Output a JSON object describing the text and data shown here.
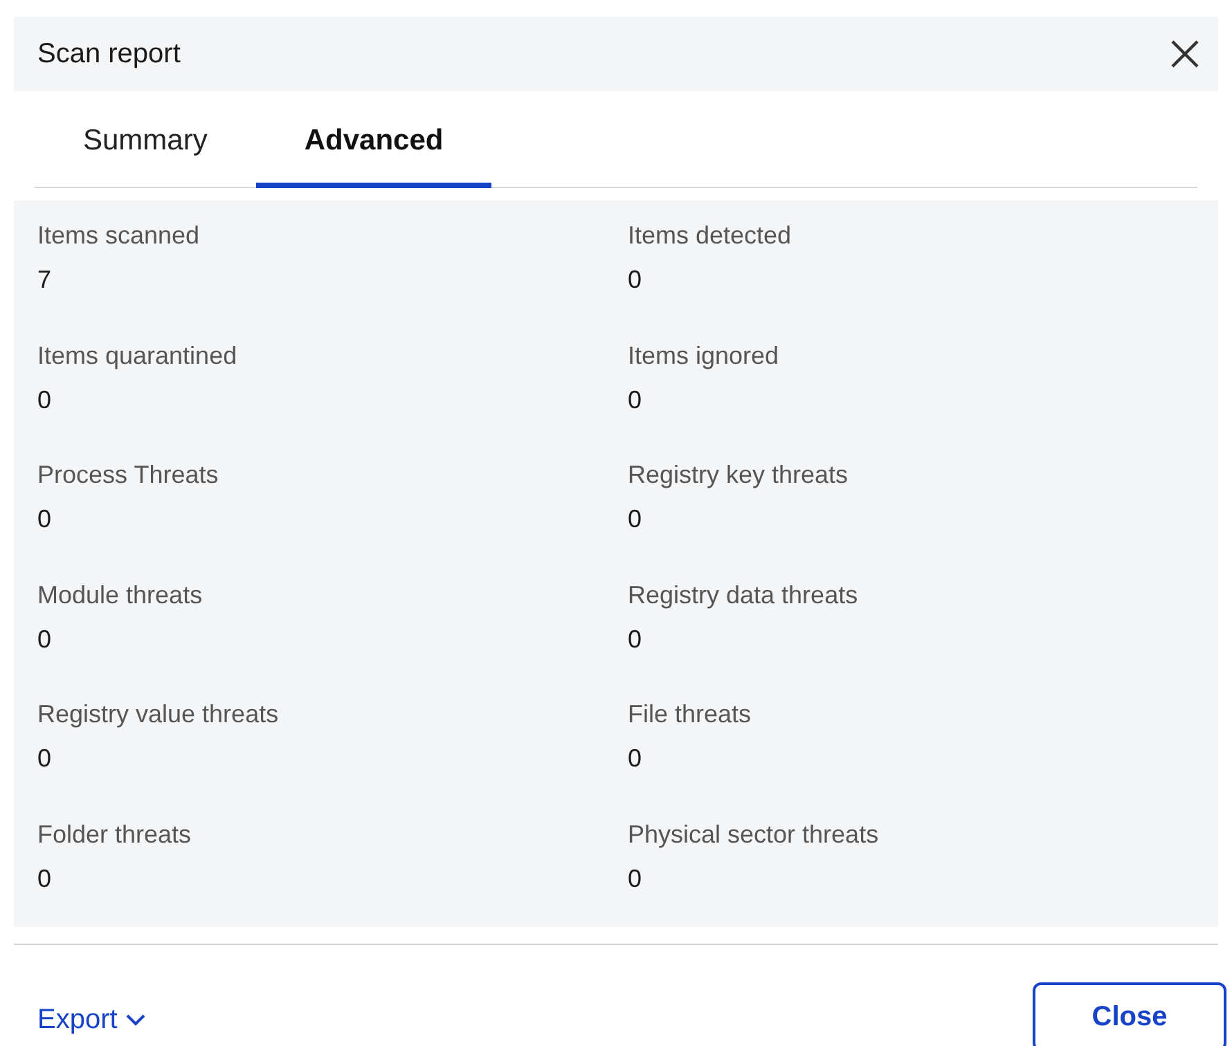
{
  "window": {
    "title": "Scan report"
  },
  "tabs": [
    {
      "label": "Summary",
      "selected": false
    },
    {
      "label": "Advanced",
      "selected": true
    }
  ],
  "stats": [
    {
      "label": "Items scanned",
      "value": "7"
    },
    {
      "label": "Items detected",
      "value": "0"
    },
    {
      "label": "Items quarantined",
      "value": "0"
    },
    {
      "label": "Items ignored",
      "value": "0"
    },
    {
      "label": "Process Threats",
      "value": "0"
    },
    {
      "label": "Registry key threats",
      "value": "0"
    },
    {
      "label": "Module threats",
      "value": "0"
    },
    {
      "label": "Registry data threats",
      "value": "0"
    },
    {
      "label": "Registry value threats",
      "value": "0"
    },
    {
      "label": "File threats",
      "value": "0"
    },
    {
      "label": "Folder threats",
      "value": "0"
    },
    {
      "label": "Physical sector threats",
      "value": "0"
    }
  ],
  "footer": {
    "export": "Export",
    "close": "Close"
  }
}
